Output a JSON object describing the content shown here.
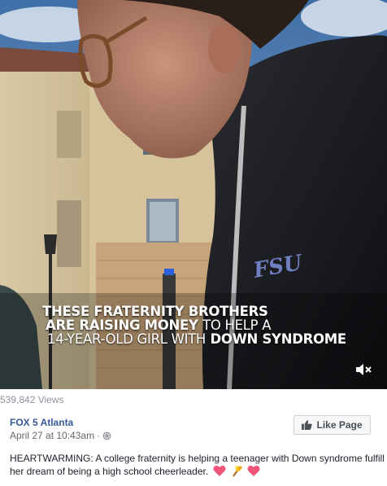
{
  "video": {
    "caption_line1": "THESE FRATERNITY BROTHERS",
    "caption_line2_a": "ARE",
    "caption_line2_b": "RAISING MONEY",
    "caption_line2_c": "TO HELP A",
    "caption_line3_a": "14-YEAR-OLD GIRL WITH",
    "caption_line3_b": "DOWN SYNDROME",
    "jacket_logo": "FSU",
    "view_count": "539,842 Views"
  },
  "post": {
    "page_name": "FOX 5 Atlanta",
    "timestamp": "April 27 at 10:43am",
    "separator": "·",
    "like_button_label": "Like Page",
    "text": "HEARTWARMING: A college fraternity is helping a teenager with Down syndrome fulfill her dream of being a high school cheerleader.",
    "emojis": [
      "heart-emoji",
      "pom-pom-emoji",
      "heart-emoji"
    ]
  },
  "colors": {
    "link": "#365899",
    "muted": "#90949c",
    "heart": "#f2547a"
  }
}
